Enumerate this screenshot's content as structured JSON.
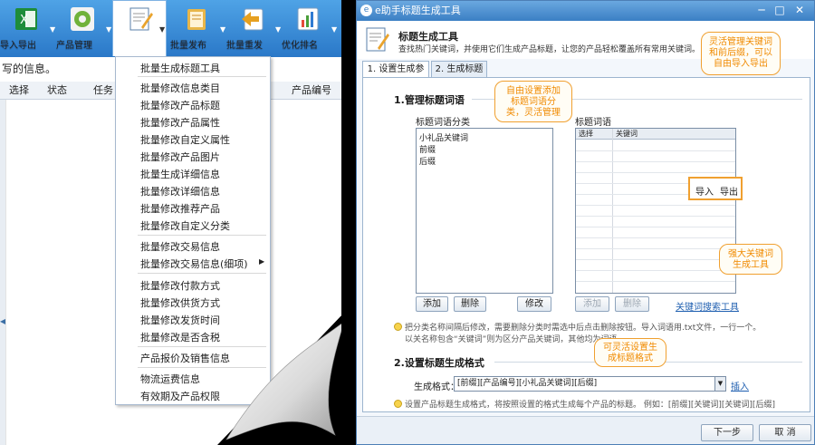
{
  "left": {
    "toolbar": [
      {
        "label": "导入导出",
        "icon": "excel-icon"
      },
      {
        "label": "产品管理",
        "icon": "gear-icon"
      },
      {
        "label": "",
        "icon": "edit-icon"
      },
      {
        "label": "批量发布",
        "icon": "book-icon"
      },
      {
        "label": "批量重发",
        "icon": "arrow-left-icon"
      },
      {
        "label": "优化排名",
        "icon": "chart-icon"
      }
    ],
    "info_text": "写的信息。",
    "grid_headers": [
      "选择",
      "状态",
      "任务",
      "产品编号"
    ],
    "dropdown": {
      "items": [
        "批量生成标题工具",
        "批量修改信息类目",
        "批量修改产品标题",
        "批量修改产品属性",
        "批量修改自定义属性",
        "批量修改产品图片",
        "批量生成详细信息",
        "批量修改详细信息",
        "批量修改推荐产品",
        "批量修改自定义分类",
        "批量修改交易信息",
        "批量修改交易信息(细项)",
        "批量修改付款方式",
        "批量修改供货方式",
        "批量修改发货时间",
        "批量修改是否含税",
        "产品报价及销售信息",
        "物流运费信息",
        "有效期及产品权限"
      ]
    }
  },
  "window": {
    "title": "e助手标题生成工具",
    "header_title": "标题生成工具",
    "header_desc": "查找热门关键词，并使用它们生成产品标题，让您的产品轻松覆盖所有常用关键词。",
    "tabs": [
      "1. 设置生成参数",
      "2. 生成标题"
    ],
    "section1": "1.管理标题词语",
    "cat_label": "标题词语分类",
    "word_label": "标题词语",
    "categories": [
      "小礼品关键词",
      "前缀",
      "后缀"
    ],
    "word_headers": [
      "选择",
      "关键词"
    ],
    "import_label": "导入",
    "export_label": "导出",
    "btn_add": "添加",
    "btn_delete": "删除",
    "btn_modify": "修改",
    "btn_add2": "添加",
    "btn_delete2": "删除",
    "keyword_tool_link": "关键词搜索工具",
    "tip1_line1": "把分类名称间隔后修改，需要删除分类时需选中后点击删除按钮。导入词语用.txt文件，一行一个。",
    "tip1_line2": "以关名称包含“关键词”则为区分产品关键词，其他均为词语",
    "section2": "2.设置标题生成格式",
    "format_label": "生成格式：",
    "format_value": "[前缀][产品编号][小礼品关键词][后缀]",
    "insert_link": "插入",
    "tip2": "设置产品标题生成格式，将按照设置的格式生成每个产品的标题。 例如：[前缀][关键词][关键词][后缀]",
    "btn_next": "下一步",
    "btn_cancel": "取 消"
  },
  "callouts": {
    "c1": [
      "灵活管理关键词",
      "和前后缀，可以",
      "自由导入导出"
    ],
    "c2": [
      "自由设置添加",
      "标题词语分",
      "类，灵活管理"
    ],
    "c3": [
      "强大关键词",
      "生成工具"
    ],
    "c4": [
      "可灵活设置生",
      "成标题格式"
    ]
  },
  "colors": {
    "toolbar_blue": "#2a78c8",
    "callout_orange": "#f08a00",
    "link_blue": "#1f5fb0"
  }
}
